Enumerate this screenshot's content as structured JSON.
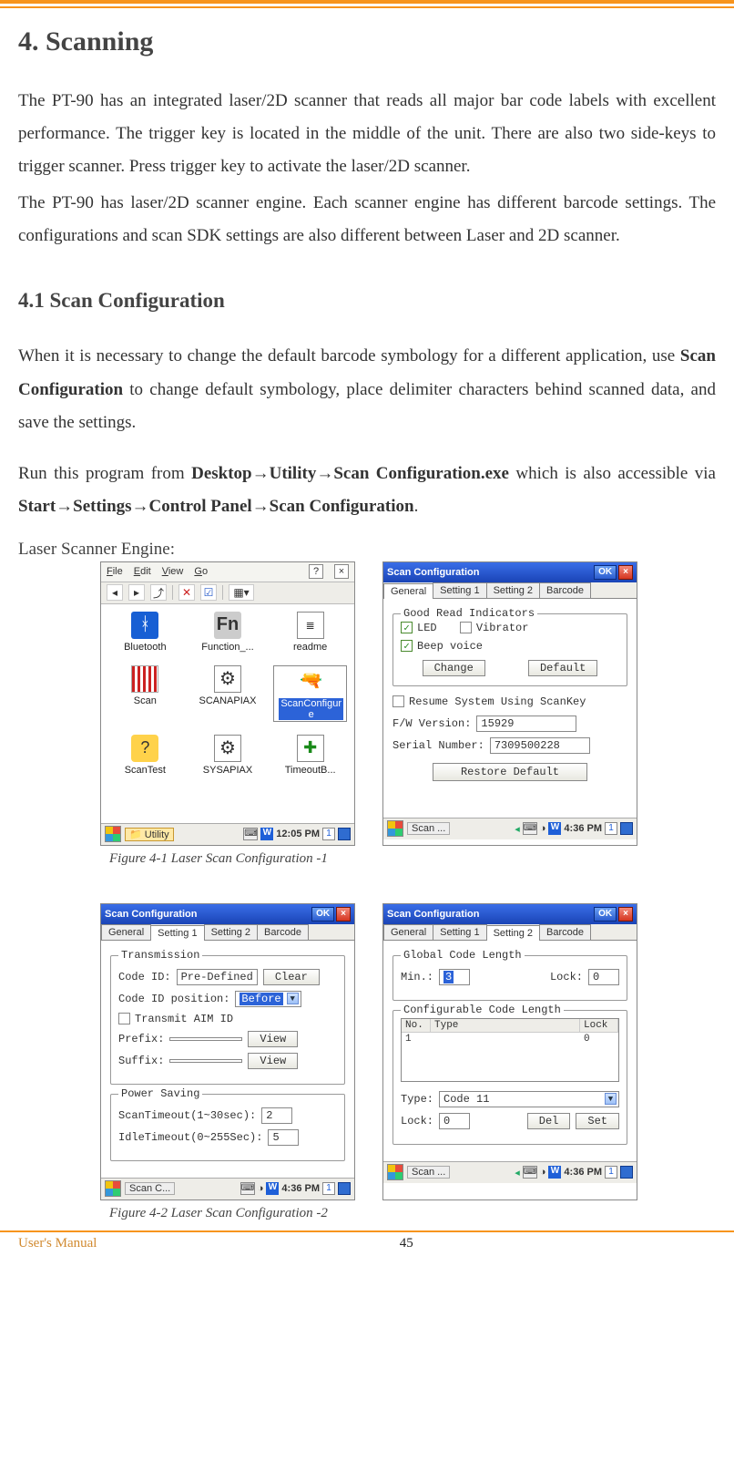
{
  "page": {
    "h1": "4.  Scanning",
    "p1": "The PT-90 has an integrated laser/2D scanner that reads all major bar code labels with excellent performance. The trigger key is located in the middle of the unit. There are also two side-keys to trigger scanner. Press trigger key to activate the laser/2D scanner.",
    "p2": "The PT-90 has laser/2D scanner engine. Each scanner engine has different barcode settings. The configurations and scan SDK settings are also different between Laser and 2D scanner.",
    "h2": "4.1  Scan Configuration",
    "p3a": "When it is necessary to change the default barcode symbology for a different application, use ",
    "p3_bold": "Scan Configuration",
    "p3b": " to change default symbology, place delimiter characters behind scanned data, and save the settings.",
    "p4a": "Run this program from ",
    "p4_b1": "Desktop→Utility→Scan Configuration.exe",
    "p4b": " which is also accessible via ",
    "p4_b2": "Start→Settings→Control Panel→Scan Configuration",
    "p4c": ".",
    "engine": "Laser Scanner Engine:",
    "fig41": "Figure 4-1 Laser Scan Configuration -1",
    "fig42": "Figure 4-2 Laser Scan Configuration -2",
    "footer_left": "User's Manual",
    "footer_page": "45"
  },
  "explorer": {
    "menus": {
      "file": "File",
      "edit": "Edit",
      "view": "View",
      "go": "Go"
    },
    "icons": {
      "bluetooth": "Bluetooth",
      "function": "Function_...",
      "readme": "readme",
      "scan": "Scan",
      "scanapiax": "SCANAPIAX",
      "scanconfigure": "ScanConfigur\ne",
      "scantest": "ScanTest",
      "sysapiax": "SYSAPIAX",
      "timeoutb": "TimeoutB..."
    },
    "taskbar": {
      "utility": "Utility",
      "time": "12:05 PM"
    }
  },
  "general": {
    "title": "Scan Configuration",
    "ok": "OK",
    "tabs": {
      "general": "General",
      "setting1": "Setting 1",
      "setting2": "Setting 2",
      "barcode": "Barcode"
    },
    "group_indicators": "Good Read Indicators",
    "led": "LED",
    "vibrator": "Vibrator",
    "beep": "Beep voice",
    "change": "Change",
    "default": "Default",
    "resume": "Resume System Using ScanKey",
    "fw_label": "F/W Version:",
    "fw_value": "15929",
    "sn_label": "Serial Number:",
    "sn_value": "7309500228",
    "restore": "Restore Default",
    "taskbar": {
      "app": "Scan ...",
      "time": "4:36 PM"
    }
  },
  "setting1": {
    "title": "Scan Configuration",
    "group_trans": "Transmission",
    "codeid_label": "Code ID:",
    "codeid_value": "Pre-Defined",
    "clear": "Clear",
    "codeidpos_label": "Code ID position:",
    "codeidpos_value": "Before",
    "transmit_aim": "Transmit AIM ID",
    "prefix": "Prefix:",
    "suffix": "Suffix:",
    "view": "View",
    "group_power": "Power Saving",
    "scantimeout_label": "ScanTimeout(1~30sec):",
    "scantimeout_value": "2",
    "idletimeout_label": "IdleTimeout(0~255Sec):",
    "idletimeout_value": "5",
    "taskbar": {
      "app": "Scan C...",
      "time": "4:36 PM"
    }
  },
  "setting2": {
    "title": "Scan Configuration",
    "group_global": "Global Code Length",
    "min_label": "Min.:",
    "min_value": "3",
    "lock_label": "Lock:",
    "lock_value": "0",
    "group_config": "Configurable Code Length",
    "hdr_no": "No.",
    "hdr_type": "Type",
    "hdr_lock": "Lock",
    "row1_no": "1",
    "row1_type": "",
    "row1_lock": "0",
    "type_label": "Type:",
    "type_value": "Code 11",
    "lock2_label": "Lock:",
    "lock2_value": "0",
    "del": "Del",
    "set": "Set",
    "taskbar": {
      "app": "Scan ...",
      "time": "4:36 PM"
    }
  }
}
